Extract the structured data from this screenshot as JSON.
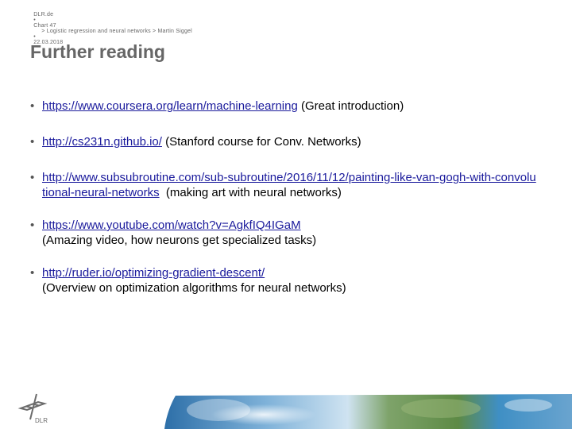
{
  "header": {
    "site": "DLR.de",
    "separator": "•",
    "chart": "Chart 47",
    "breadcrumb": "> Logistic regression and neural networks > Martin Siggel",
    "date": "22.03.2018"
  },
  "title": "Further reading",
  "items": [
    {
      "link": "https://www.coursera.org/learn/machine-learning",
      "note": " (Great introduction)"
    },
    {
      "link": "http://cs231n.github.io/",
      "note": " (Stanford course for Conv. Networks)"
    },
    {
      "link": "http://www.subsubroutine.com/sub-subroutine/2016/11/12/painting-like-van-gogh-with-convolutional-neural-networks",
      "note": "  (making art with neural networks)"
    },
    {
      "link": "https://www.youtube.com/watch?v=AgkfIQ4IGaM",
      "note": "(Amazing video, how neurons get specialized tasks)"
    },
    {
      "link": "http://ruder.io/optimizing-gradient-descent/",
      "note": "(Overview on optimization algorithms for neural networks)"
    }
  ],
  "bullet": "•",
  "logo": {
    "icon": "dlr-logo-icon",
    "text": "DLR"
  },
  "colors": {
    "link": "#1a1a9c",
    "title": "#666666",
    "text": "#000000"
  }
}
